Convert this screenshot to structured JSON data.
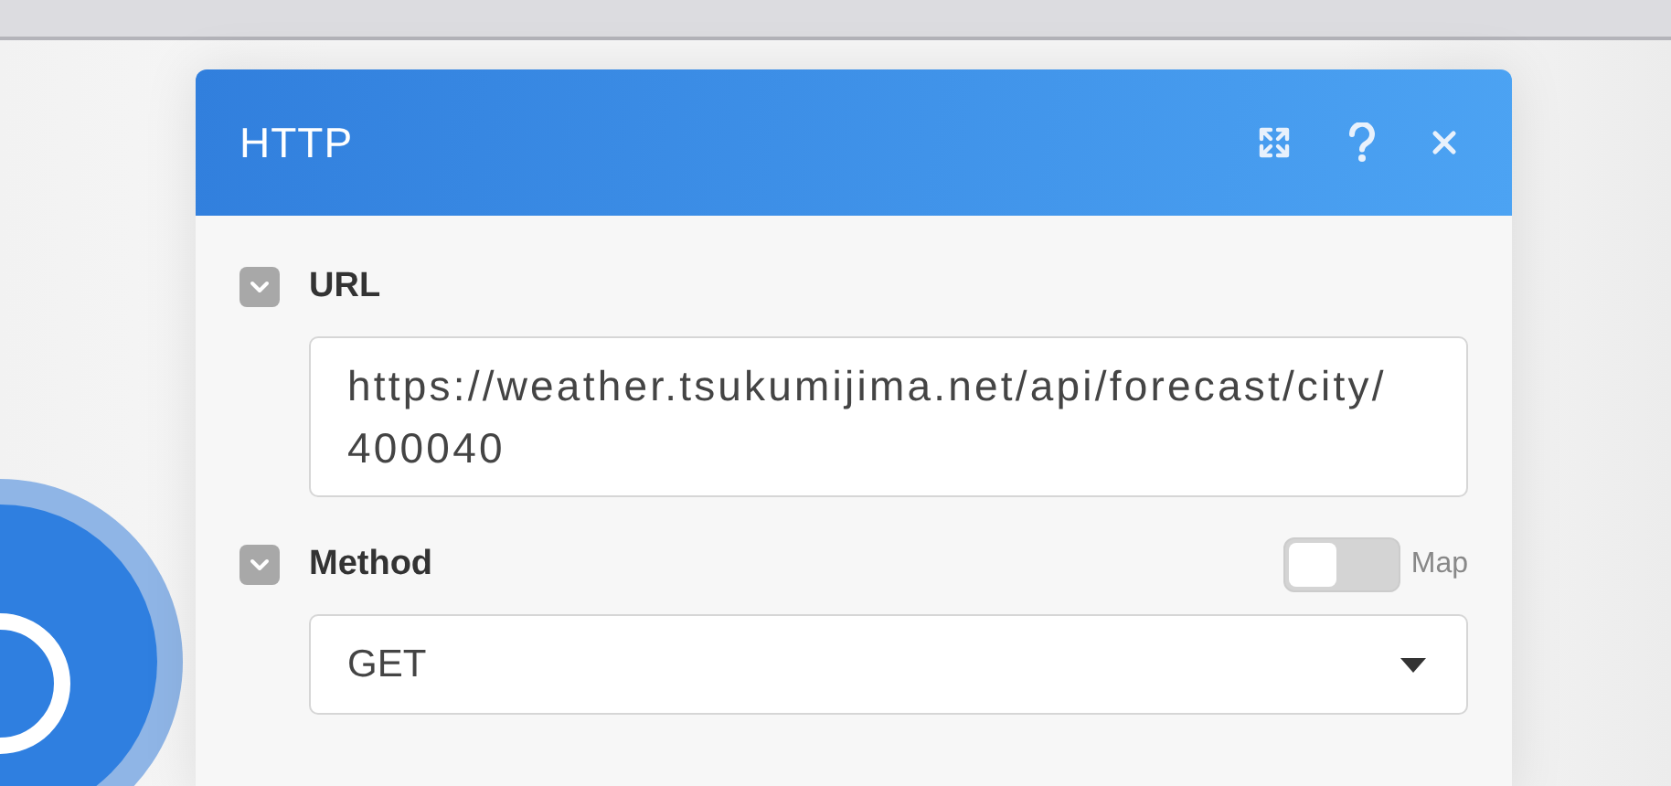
{
  "dialog": {
    "title": "HTTP"
  },
  "fields": [
    {
      "kind": "text",
      "label": "URL",
      "expanded": true,
      "value": "https://weather.tsukumijima.net/api/forecast/city/400040"
    },
    {
      "kind": "select",
      "label": "Method",
      "expanded": true,
      "value": "GET",
      "map_toggle": {
        "label": "Map",
        "on": false
      }
    }
  ]
}
